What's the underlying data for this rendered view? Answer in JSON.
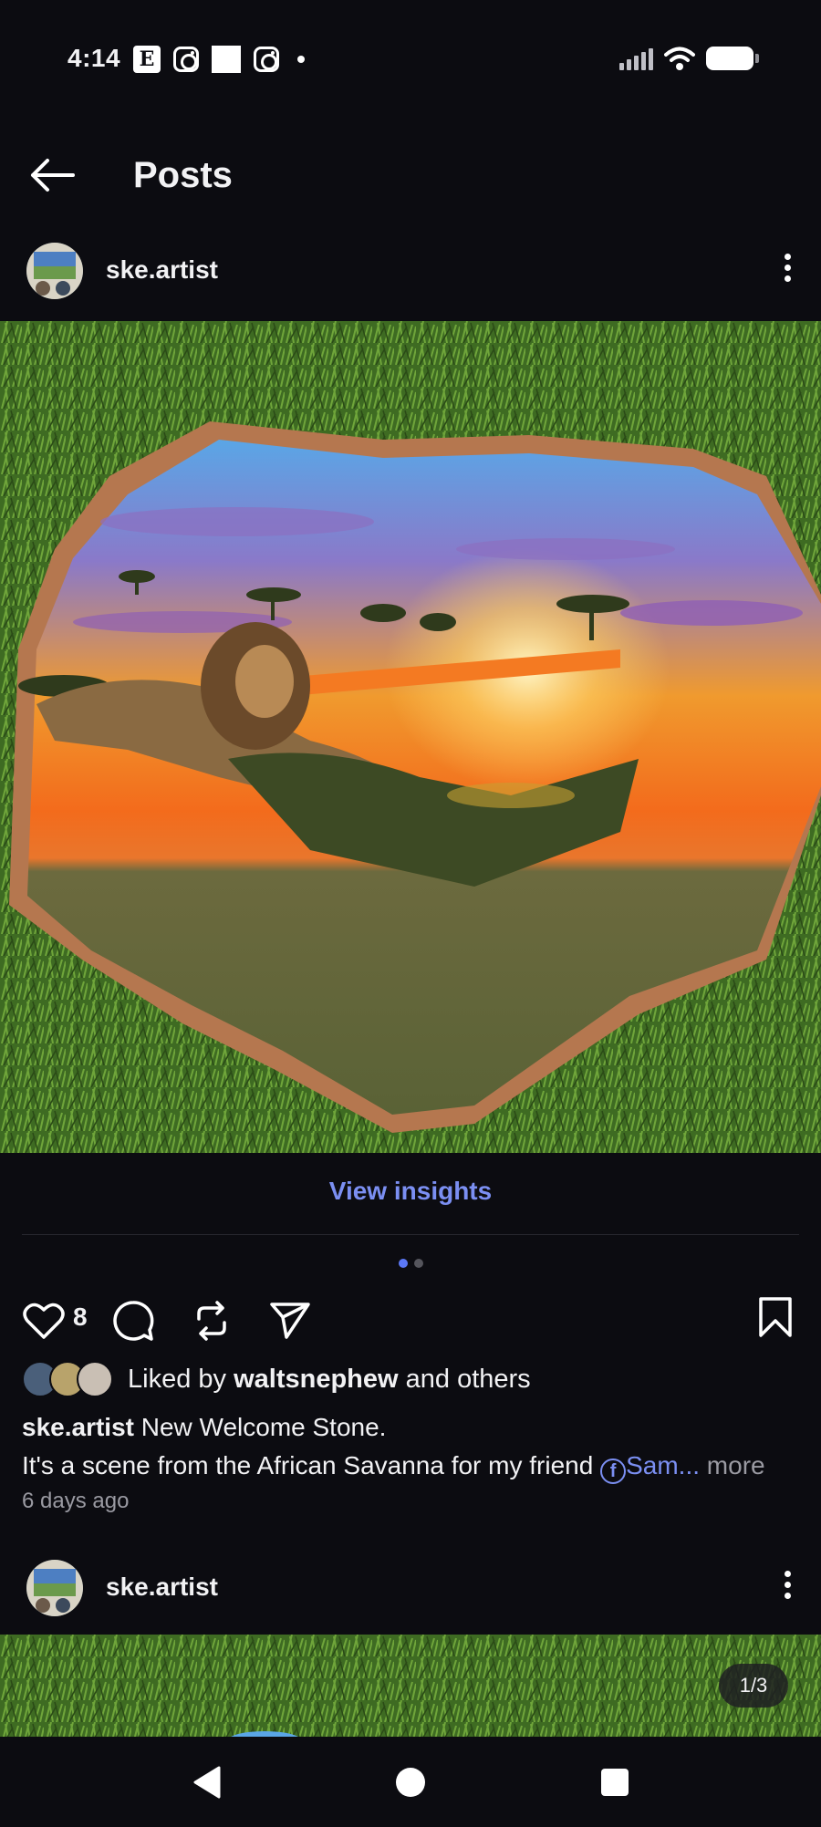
{
  "status": {
    "time": "4:14",
    "notif_e": "E"
  },
  "header": {
    "title": "Posts"
  },
  "post1": {
    "username": "ske.artist",
    "insights_label": "View insights",
    "like_count": "8",
    "liked_by_prefix": "Liked by ",
    "liked_by_user": "waltsnephew",
    "liked_by_suffix": " and others",
    "caption_username": "ske.artist",
    "caption_line1": " New Welcome Stone.",
    "caption_line2": "It's a scene from the African Savanna for my friend ",
    "mention": "Sam...",
    "more_label": " more",
    "timestamp": "6 days ago"
  },
  "post2": {
    "username": "ske.artist",
    "counter": "1/3"
  },
  "colors": {
    "accent": "#7b8ff2",
    "background": "#0c0c11",
    "active_dot": "#5b78f6"
  },
  "icons": [
    "back-arrow-icon",
    "more-vertical-icon",
    "heart-icon",
    "comment-icon",
    "repost-icon",
    "share-icon",
    "bookmark-icon",
    "facebook-icon"
  ]
}
